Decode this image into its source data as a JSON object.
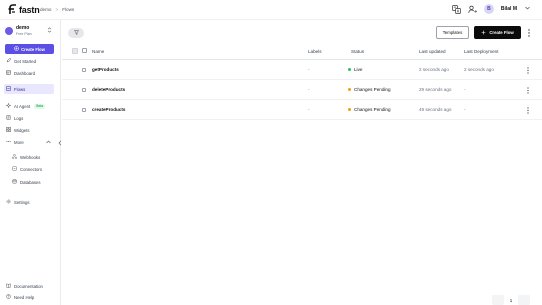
{
  "colors": {
    "accent": "#5b4fe4",
    "live": "#22c55e",
    "pending": "#f59e0b",
    "nav_active_bg": "#e9e7ff"
  },
  "brand": {
    "name": "fastn",
    "icon": "fastn-logo-icon"
  },
  "breadcrumb": {
    "items": [
      "demo",
      "Flows"
    ],
    "separator": ">"
  },
  "header": {
    "icons": [
      "translate-icon",
      "user-switch-icon"
    ],
    "avatar_initial": "B",
    "user_name": "Bilal M"
  },
  "workspace": {
    "name": "demo",
    "plan": "Free Plan"
  },
  "sidebar": {
    "create_flow_label": "Create Flow",
    "items": [
      {
        "label": "Get Started",
        "icon": "rocket-icon"
      },
      {
        "label": "Dashboard",
        "icon": "dashboard-icon"
      },
      {
        "label": "Flows",
        "icon": "flows-icon",
        "active": true
      },
      {
        "label": "AI Agent",
        "icon": "ai-agent-icon",
        "badge": "Beta"
      },
      {
        "label": "Logs",
        "icon": "logs-icon"
      },
      {
        "label": "Widgets",
        "icon": "widgets-icon"
      },
      {
        "label": "More",
        "icon": "more-icon"
      },
      {
        "label": "Webhooks",
        "icon": "webhooks-icon"
      },
      {
        "label": "Connectors",
        "icon": "connectors-icon"
      },
      {
        "label": "Databases",
        "icon": "databases-icon"
      },
      {
        "label": "Settings",
        "icon": "settings-icon"
      },
      {
        "label": "Documentation",
        "icon": "documentation-icon"
      },
      {
        "label": "Need Help",
        "icon": "help-icon"
      }
    ]
  },
  "toolbar": {
    "templates_label": "Templates",
    "create_flow_label": "Create Flow"
  },
  "table": {
    "columns": [
      "Name",
      "Labels",
      "Status",
      "Last updated",
      "Last Deployment"
    ],
    "rows": [
      {
        "name": "getProducts",
        "labels": "-",
        "status": "Live",
        "status_color": "#22c55e",
        "last_updated": "2 seconds ago",
        "last_deployment": "2 seconds ago"
      },
      {
        "name": "deleteProducts",
        "labels": "-",
        "status": "Changes Pending",
        "status_color": "#f59e0b",
        "last_updated": "29 seconds ago",
        "last_deployment": "-"
      },
      {
        "name": "createProducts",
        "labels": "-",
        "status": "Changes Pending",
        "status_color": "#f59e0b",
        "last_updated": "49 seconds ago",
        "last_deployment": "-"
      }
    ]
  },
  "pagination": {
    "current_page": "1"
  }
}
